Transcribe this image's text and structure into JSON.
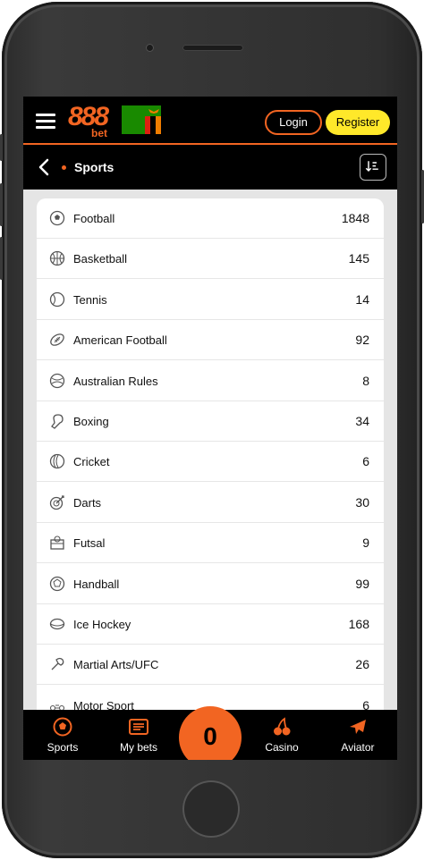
{
  "header": {
    "logo_number": "888",
    "logo_sub": "bet",
    "login_label": "Login",
    "register_label": "Register"
  },
  "subheader": {
    "title": "Sports"
  },
  "sports": [
    {
      "name": "Football",
      "count": "1848",
      "icon": "football-icon"
    },
    {
      "name": "Basketball",
      "count": "145",
      "icon": "basketball-icon"
    },
    {
      "name": "Tennis",
      "count": "14",
      "icon": "tennis-icon"
    },
    {
      "name": "American Football",
      "count": "92",
      "icon": "american-football-icon"
    },
    {
      "name": "Australian Rules",
      "count": "8",
      "icon": "australian-rules-icon"
    },
    {
      "name": "Boxing",
      "count": "34",
      "icon": "boxing-icon"
    },
    {
      "name": "Cricket",
      "count": "6",
      "icon": "cricket-icon"
    },
    {
      "name": "Darts",
      "count": "30",
      "icon": "darts-icon"
    },
    {
      "name": "Futsal",
      "count": "9",
      "icon": "futsal-icon"
    },
    {
      "name": "Handball",
      "count": "99",
      "icon": "handball-icon"
    },
    {
      "name": "Ice Hockey",
      "count": "168",
      "icon": "ice-hockey-icon"
    },
    {
      "name": "Martial Arts/UFC",
      "count": "26",
      "icon": "martial-arts-icon"
    },
    {
      "name": "Motor Sport",
      "count": "6",
      "icon": "motor-sport-icon"
    }
  ],
  "bottom_nav": {
    "sports_label": "Sports",
    "mybets_label": "My bets",
    "betslip_count": "0",
    "casino_label": "Casino",
    "aviator_label": "Aviator"
  },
  "colors": {
    "accent": "#f26522",
    "register": "#ffe82a",
    "bar": "#000000"
  }
}
